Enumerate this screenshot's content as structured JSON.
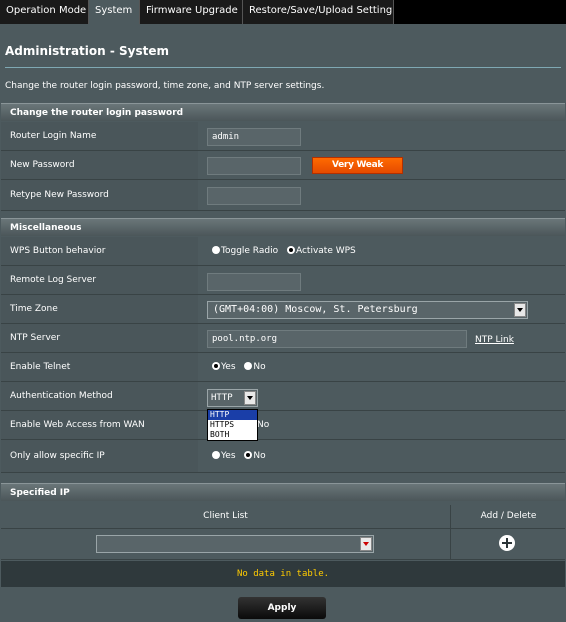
{
  "tabs": [
    "Operation Mode",
    "System",
    "Firmware Upgrade",
    "Restore/Save/Upload Setting"
  ],
  "page_title": "Administration - System",
  "description": "Change the router login password, time zone, and NTP server settings.",
  "login_section": {
    "header": "Change the router login password",
    "login_name_label": "Router Login Name",
    "login_name_value": "admin",
    "new_password_label": "New Password",
    "new_password_value": "",
    "strength": "Very Weak",
    "retype_label": "Retype New Password",
    "retype_value": ""
  },
  "misc_section": {
    "header": "Miscellaneous",
    "wps_label": "WPS Button behavior",
    "wps_option1": "Toggle Radio",
    "wps_option2": "Activate WPS",
    "remote_log_label": "Remote Log Server",
    "remote_log_value": "",
    "timezone_label": "Time Zone",
    "timezone_value": "(GMT+04:00) Moscow, St. Petersburg",
    "ntp_label": "NTP Server",
    "ntp_value": "pool.ntp.org",
    "ntp_link": "NTP Link",
    "telnet_label": "Enable Telnet",
    "yes": "Yes",
    "no": "No",
    "auth_label": "Authentication Method",
    "auth_value": "HTTP",
    "auth_options": [
      "HTTP",
      "HTTPS",
      "BOTH"
    ],
    "wan_access_label": "Enable Web Access from WAN",
    "wan_access_no": "No",
    "specific_ip_label": "Only allow specific IP"
  },
  "specified_ip": {
    "header": "Specified IP",
    "col_client": "Client List",
    "col_add": "Add / Delete",
    "empty": "No data in table."
  },
  "apply_label": "Apply",
  "colors": {
    "strength_bg": "#ff6a00",
    "nodata_text": "#ffcc00",
    "dropdown_selected": "#1a3ea8"
  }
}
